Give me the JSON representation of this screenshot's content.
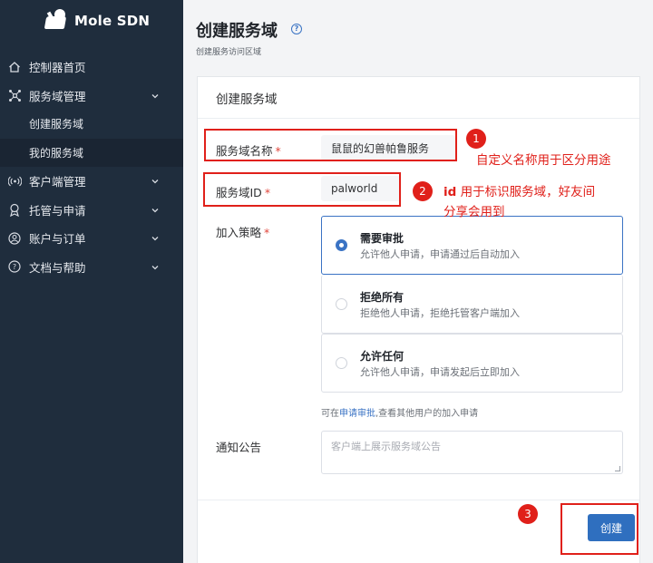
{
  "brand": {
    "name": "Mole SDN"
  },
  "sidebar": {
    "items": [
      {
        "label": "控制器首页",
        "icon": "home-icon"
      },
      {
        "label": "服务域管理",
        "icon": "cluster-icon",
        "expanded": true,
        "children": [
          {
            "label": "创建服务域"
          },
          {
            "label": "我的服务域",
            "active": true
          }
        ]
      },
      {
        "label": "客户端管理",
        "icon": "broadcast-icon"
      },
      {
        "label": "托管与申请",
        "icon": "award-icon"
      },
      {
        "label": "账户与订单",
        "icon": "user-circle-icon"
      },
      {
        "label": "文档与帮助",
        "icon": "question-circle-icon"
      }
    ]
  },
  "page": {
    "title": "创建服务域",
    "subtitle": "创建服务访问区域"
  },
  "form": {
    "card_title": "创建服务域",
    "name": {
      "label": "服务域名称",
      "required": "*",
      "value": "鼠鼠的幻兽帕鲁服务"
    },
    "domain_id": {
      "label": "服务域ID",
      "required": "*",
      "value": "palworld"
    },
    "policy": {
      "label": "加入策略",
      "required": "*",
      "options": [
        {
          "title": "需要审批",
          "desc": "允许他人申请，申请通过后自动加入",
          "selected": true
        },
        {
          "title": "拒绝所有",
          "desc": "拒绝他人申请，拒绝托管客户端加入",
          "selected": false
        },
        {
          "title": "允许任何",
          "desc": "允许他人申请，申请发起后立即加入",
          "selected": false
        }
      ],
      "hint_prefix": "可在",
      "hint_link": "申请审批",
      "hint_suffix": ",查看其他用户的加入申请"
    },
    "notice": {
      "label": "通知公告",
      "placeholder": "客户端上展示服务域公告"
    },
    "submit_label": "创建"
  },
  "annotations": {
    "n1": "1",
    "n2": "2",
    "n3": "3",
    "text1": "自定义名称用于区分用途",
    "text2_bold": "id",
    "text2_line1": " 用于标识服务域，好友间",
    "text2_line2": "分享会用到",
    "color": "#e0201a"
  },
  "colors": {
    "sidebar_bg": "#1f2d3d",
    "primary": "#2f6fbf",
    "accent": "#3a73c4"
  }
}
